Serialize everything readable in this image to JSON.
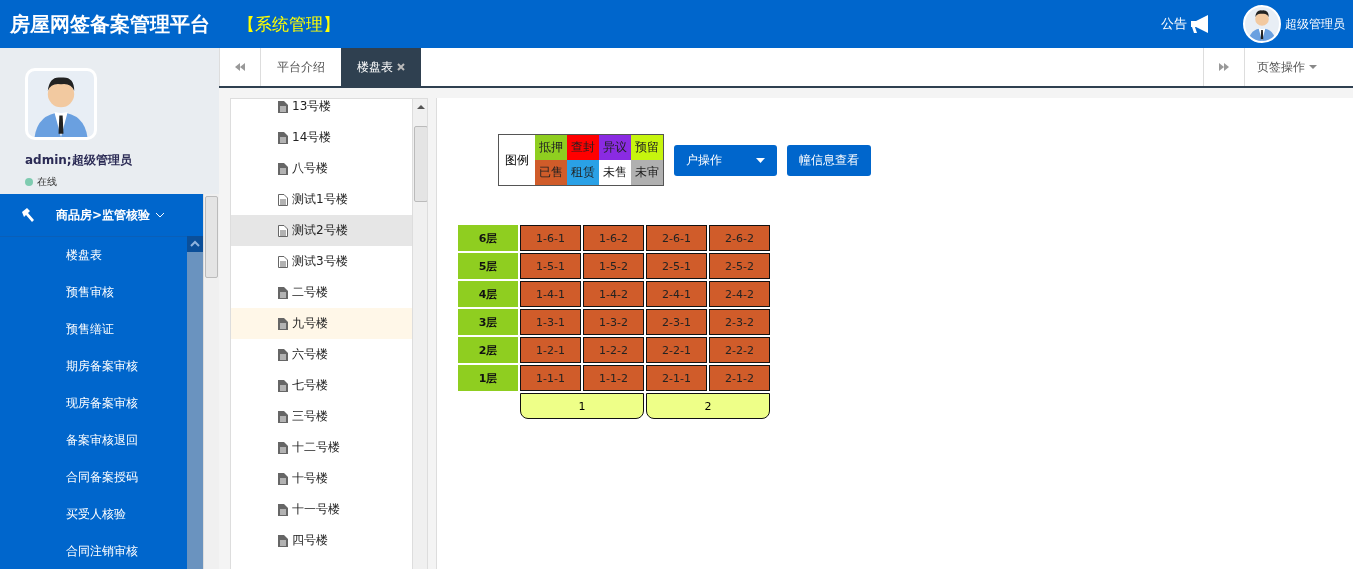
{
  "header": {
    "title": "房屋网签备案管理平台",
    "section": "【系统管理】",
    "notice": "公告",
    "user": "超级管理员"
  },
  "profile": {
    "name": "admin;超级管理员",
    "status": {
      "label": "在线",
      "color": "#7ecbb0"
    }
  },
  "menu": {
    "group": {
      "label": "商品房>监管核验",
      "expanded": true
    },
    "items": [
      "楼盘表",
      "预售审核",
      "预售缮证",
      "期房备案审核",
      "现房备案审核",
      "备案审核退回",
      "合同备案授码",
      "买受人核验",
      "合同注销审核"
    ]
  },
  "tabs": [
    {
      "label": "平台介绍",
      "selected": false,
      "closable": false
    },
    {
      "label": "楼盘表",
      "selected": true,
      "closable": true
    }
  ],
  "tab_menu": "页签操作",
  "tree": [
    {
      "label": "13号楼",
      "kind": "file",
      "selected": false,
      "hovered": false
    },
    {
      "label": "14号楼",
      "kind": "file",
      "selected": false,
      "hovered": false
    },
    {
      "label": "八号楼",
      "kind": "file",
      "selected": false,
      "hovered": false
    },
    {
      "label": "测试1号楼",
      "kind": "outline",
      "selected": false,
      "hovered": false
    },
    {
      "label": "测试2号楼",
      "kind": "outline",
      "selected": false,
      "hovered": true
    },
    {
      "label": "测试3号楼",
      "kind": "outline",
      "selected": false,
      "hovered": false
    },
    {
      "label": "二号楼",
      "kind": "file",
      "selected": false,
      "hovered": false
    },
    {
      "label": "九号楼",
      "kind": "file",
      "selected": true,
      "hovered": false
    },
    {
      "label": "六号楼",
      "kind": "file",
      "selected": false,
      "hovered": false
    },
    {
      "label": "七号楼",
      "kind": "file",
      "selected": false,
      "hovered": false
    },
    {
      "label": "三号楼",
      "kind": "file",
      "selected": false,
      "hovered": false
    },
    {
      "label": "十二号楼",
      "kind": "file",
      "selected": false,
      "hovered": false
    },
    {
      "label": "十号楼",
      "kind": "file",
      "selected": false,
      "hovered": false
    },
    {
      "label": "十一号楼",
      "kind": "file",
      "selected": false,
      "hovered": false
    },
    {
      "label": "四号楼",
      "kind": "file",
      "selected": false,
      "hovered": false
    }
  ],
  "legend": {
    "title": "图例",
    "items": [
      {
        "label": "抵押",
        "color": "#8fce20"
      },
      {
        "label": "查封",
        "color": "#ff0000"
      },
      {
        "label": "异议",
        "color": "#8a2be2"
      },
      {
        "label": "预留",
        "color": "#c6f50e"
      },
      {
        "label": "已售",
        "color": "#d05c2a"
      },
      {
        "label": "租赁",
        "color": "#2aa1e6"
      },
      {
        "label": "未售",
        "color": "#ffffff"
      },
      {
        "label": "未审",
        "color": "#b0b0b0"
      }
    ]
  },
  "buttons": [
    {
      "label": "户操作",
      "kind": "dropdown"
    },
    {
      "label": "幢信息查看",
      "kind": "plain"
    }
  ],
  "board": {
    "floors": [
      {
        "label": "6层",
        "units": [
          {
            "label": "1-6-1",
            "color": "#d05c2a"
          },
          {
            "label": "1-6-2",
            "color": "#d05c2a"
          },
          {
            "label": "2-6-1",
            "color": "#d05c2a"
          },
          {
            "label": "2-6-2",
            "color": "#d05c2a"
          }
        ]
      },
      {
        "label": "5层",
        "units": [
          {
            "label": "1-5-1",
            "color": "#d05c2a"
          },
          {
            "label": "1-5-2",
            "color": "#d05c2a"
          },
          {
            "label": "2-5-1",
            "color": "#d05c2a"
          },
          {
            "label": "2-5-2",
            "color": "#d05c2a"
          }
        ]
      },
      {
        "label": "4层",
        "units": [
          {
            "label": "1-4-1",
            "color": "#d05c2a"
          },
          {
            "label": "1-4-2",
            "color": "#d05c2a"
          },
          {
            "label": "2-4-1",
            "color": "#d05c2a"
          },
          {
            "label": "2-4-2",
            "color": "#d05c2a"
          }
        ]
      },
      {
        "label": "3层",
        "units": [
          {
            "label": "1-3-1",
            "color": "#d05c2a"
          },
          {
            "label": "1-3-2",
            "color": "#d05c2a"
          },
          {
            "label": "2-3-1",
            "color": "#d05c2a"
          },
          {
            "label": "2-3-2",
            "color": "#d05c2a"
          }
        ]
      },
      {
        "label": "2层",
        "units": [
          {
            "label": "1-2-1",
            "color": "#d05c2a"
          },
          {
            "label": "1-2-2",
            "color": "#d05c2a"
          },
          {
            "label": "2-2-1",
            "color": "#d05c2a"
          },
          {
            "label": "2-2-2",
            "color": "#d05c2a"
          }
        ]
      },
      {
        "label": "1层",
        "units": [
          {
            "label": "1-1-1",
            "color": "#d05c2a"
          },
          {
            "label": "1-1-2",
            "color": "#d05c2a"
          },
          {
            "label": "2-1-1",
            "color": "#d05c2a"
          },
          {
            "label": "2-1-2",
            "color": "#d05c2a"
          }
        ]
      }
    ],
    "blocks": [
      "1",
      "2"
    ]
  }
}
